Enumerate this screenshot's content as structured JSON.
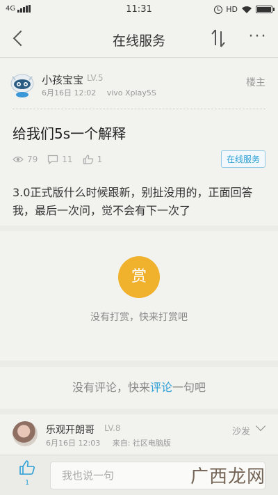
{
  "status_bar": {
    "network": "4G",
    "time": "11:31",
    "hd": "HD"
  },
  "nav": {
    "title": "在线服务",
    "more": "···"
  },
  "post": {
    "author": "小孩宝宝",
    "level": "LV.5",
    "date": "6月16日 12:02",
    "device": "vivo Xplay5S",
    "floor": "楼主",
    "title": "给我们5s一个解释",
    "views": "79",
    "comments": "11",
    "likes": "1",
    "tag": "在线服务",
    "body": "3.0正式版什么时候跟新，别扯没用的，正面回答我，最后一次问，觉不会有下一次了"
  },
  "reward": {
    "button": "赏",
    "text": "没有打赏，快来打赏吧"
  },
  "comments_empty": {
    "prefix": "没有评论，快来",
    "link": "评论",
    "suffix": "一句吧"
  },
  "reply": {
    "author": "乐观开朗哥",
    "level": "LV.8",
    "date": "6月16日 12:03",
    "source": "来自: 社区电脑版",
    "floor": "沙发"
  },
  "bottom": {
    "like_count": "1",
    "input_placeholder": "我也说一句",
    "watermark": "广西龙网"
  },
  "colors": {
    "accent": "#2a9fd6",
    "reward": "#f0b22c",
    "background": "#ebebe8"
  },
  "icons": [
    "back-arrow-icon",
    "sort-icon",
    "more-icon",
    "robot-avatar",
    "eye-icon",
    "comment-icon",
    "thumb-up-icon",
    "chevron-down-icon"
  ]
}
